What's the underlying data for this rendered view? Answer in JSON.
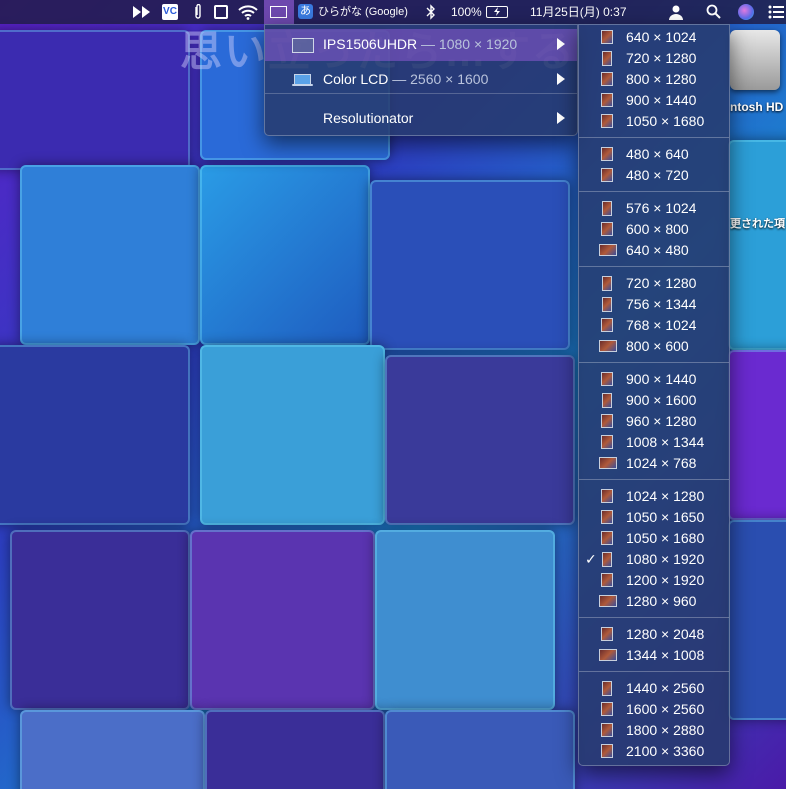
{
  "menubar": {
    "input_method": "ひらがな (Google)",
    "input_mode_glyph": "あ",
    "battery": "100%",
    "datetime": "11月25日(月)  0:37"
  },
  "desktop": {
    "disk_label": "ntosh HD",
    "side_text": "更された項",
    "watermark": "思い立ったら…する"
  },
  "display_menu": {
    "items": [
      {
        "name": "IPS1506UHDR",
        "detail": " — 1080 × 1920",
        "icon": "monitor-icon",
        "selected": true
      },
      {
        "name": "Color LCD",
        "detail": " — 2560 × 1600",
        "icon": "laptop-icon",
        "selected": false
      },
      {
        "name": "Resolutionator",
        "detail": "",
        "icon": "",
        "selected": false
      }
    ]
  },
  "resolution_menu": {
    "groups": [
      [
        "640 × 1024",
        "720 × 1280",
        "800 × 1280",
        "900 × 1440",
        "1050 × 1680"
      ],
      [
        "480 × 640",
        "480 × 720"
      ],
      [
        "576 × 1024",
        "600 × 800",
        "640 × 480"
      ],
      [
        "720 × 1280",
        "756 × 1344",
        "768 × 1024",
        "800 × 600"
      ],
      [
        "900 × 1440",
        "900 × 1600",
        "960 × 1280",
        "1008 × 1344",
        "1024 × 768"
      ],
      [
        "1024 × 1280",
        "1050 × 1650",
        "1050 × 1680",
        "1080 × 1920",
        "1200 × 1920",
        "1280 × 960"
      ],
      [
        "1280 × 2048",
        "1344 × 1008"
      ],
      [
        "1440 × 2560",
        "1600 × 2560",
        "1800 × 2880",
        "2100 × 3360"
      ]
    ],
    "checked": "1080 × 1920",
    "check_mark": "✓"
  }
}
